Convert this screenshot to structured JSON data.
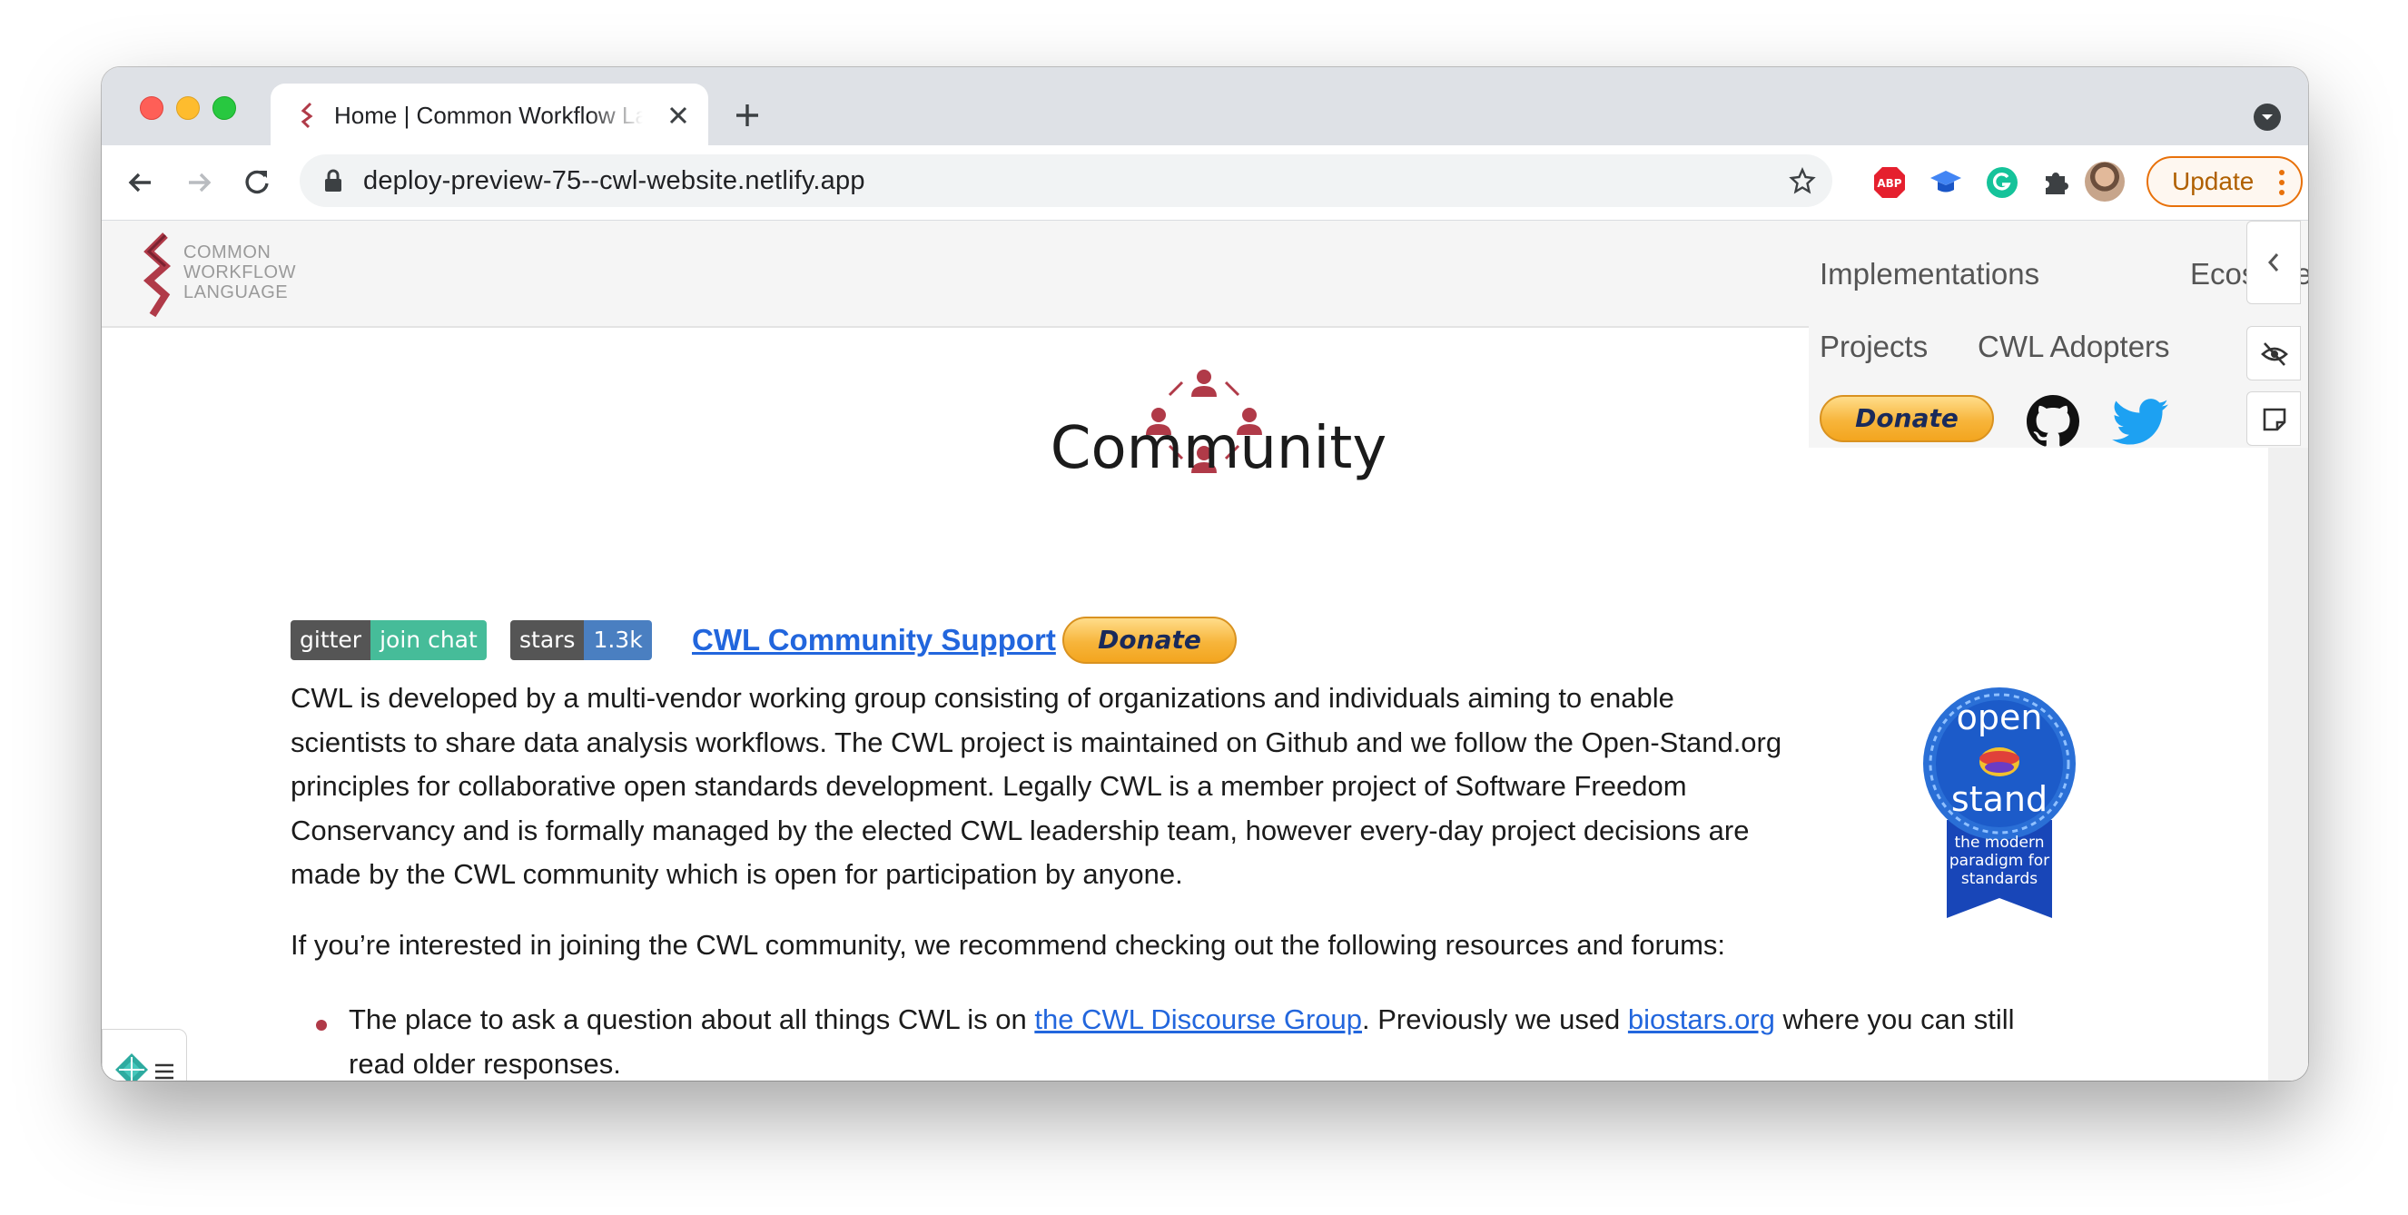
{
  "browser": {
    "tab_title": "Home | Common Workflow Language",
    "url": "deploy-preview-75--cwl-website.netlify.app",
    "update_label": "Update"
  },
  "site": {
    "logo_lines": [
      "COMMON",
      "WORKFLOW",
      "LANGUAGE"
    ],
    "nav": {
      "implementations": "Implementations",
      "ecosystem": "Ecosystem",
      "projects": "Projects",
      "cwl_adopters": "CWL Adopters",
      "donate": "Donate"
    }
  },
  "main": {
    "title": "Community",
    "badges": {
      "gitter_left": "gitter",
      "gitter_right": "join chat",
      "stars_left": "stars",
      "stars_right": "1.3k"
    },
    "support_link": "CWL Community Support",
    "donate": "Donate",
    "intro_lines": [
      "CWL is developed by a multi-vendor working group consisting of organizations and individuals aiming to enable",
      "scientists to share data analysis workflows. The CWL project is maintained on Github and we follow the Open-Stand.org",
      "principles for collaborative open standards development. Legally CWL is a member project of Software Freedom",
      "Conservancy and is formally managed by the elected CWL leadership team, however every-day project decisions are",
      "made by the CWL community which is open for participation by anyone."
    ],
    "join_text": "If you’re interested in joining the CWL community, we recommend checking out the following resources and forums:",
    "bullet": {
      "before": "The place to ask a question about all things CWL is on ",
      "link1": "the CWL Discourse Group",
      "middle": ". Previously we used ",
      "link2": "biostars.org",
      "after": " where you can still",
      "line2": "read older responses."
    },
    "openstand": {
      "word1": "open",
      "word2": "stand",
      "tagline": [
        "the modern",
        "paradigm for",
        "standards"
      ]
    }
  },
  "colors": {
    "accent": "#b03a48",
    "link": "#2266dd",
    "gitter_green": "#46bc99",
    "stars_blue": "#4a7fc1"
  }
}
